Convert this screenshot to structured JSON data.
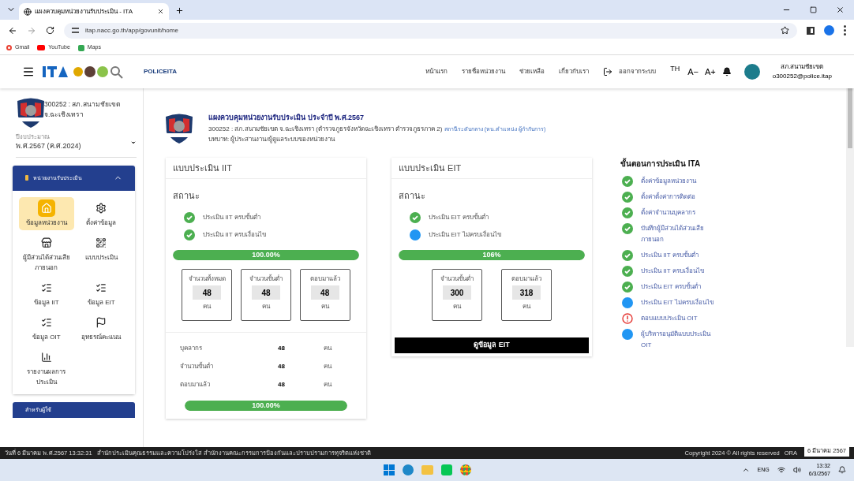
{
  "browser": {
    "tab_title": "แผงควบคุมหน่วยงานรับประเมิน - ITA",
    "url": "itap.nacc.go.th/app/govunit/home",
    "bookmarks": [
      {
        "label": "Gmail",
        "kind": "g"
      },
      {
        "label": "YouTube",
        "kind": "yt"
      },
      {
        "label": "Maps",
        "kind": "maps"
      }
    ]
  },
  "header": {
    "brand": "POLICEITA",
    "nav": [
      "หน้าแรก",
      "รายชื่อหน่วยงาน",
      "ช่วยเหลือ",
      "เกี่ยวกับเรา"
    ],
    "logout": "ออกจากระบบ",
    "lang": "TH",
    "font_down": "A−",
    "font_up": "A+",
    "user_name": "สภ.สนามชัยเขต",
    "user_email": "o300252@police.itap"
  },
  "sidebar": {
    "unit": "300252 : สภ.สนามชัยเขต จ.ฉะเชิงเทรา",
    "year_label": "ปีงบประมาณ",
    "year_value": "พ.ศ.2567 (ค.ศ.2024)",
    "section_title": "หน่วยงานรับประเมิน",
    "expanded": true,
    "items": [
      {
        "label": "ข้อมูลหน่วยงาน",
        "selected": true
      },
      {
        "label": "ตั้งค่าข้อมูล",
        "selected": false
      },
      {
        "label": "ผู้มีส่วนได้ส่วนเสียภายนอก",
        "selected": false
      },
      {
        "label": "แบบประเมิน",
        "selected": false
      },
      {
        "label": "ข้อมูล IIT",
        "selected": false
      },
      {
        "label": "ข้อมูล EIT",
        "selected": false
      },
      {
        "label": "ข้อมูล OIT",
        "selected": false
      },
      {
        "label": "อุทธรณ์คะแนน",
        "selected": false
      },
      {
        "label": "รายงานผลการประเมิน",
        "selected": false
      }
    ],
    "next_section": "สำหรับผู้ใช้"
  },
  "main": {
    "title": "แผงควบคุมหน่วยงานรับประเมิน ประจำปี พ.ศ.2567",
    "unit_line": "300252 : สภ.สนามชัยเขต จ.ฉะเชิงเทรา (ตำรวจภูธรจังหวัดฉะเชิงเทรา ตำรวจภูธรภาค 2)",
    "unit_link": "สถานีระดับกลาง (หน.ตำแหน่ง ผู้กำกับการ)",
    "role": "บทบาท: ผู้ประสานงาน/ผู้ดูแลระบบของหน่วยงาน"
  },
  "iit": {
    "title": "แบบประเมิน IIT",
    "status_label": "สถานะ",
    "statuses": [
      {
        "text": "ประเมิน IIT ครบขั้นต่ำ",
        "kind": "done"
      },
      {
        "text": "ประเมิน IIT ครบเงื่อนไข",
        "kind": "done"
      }
    ],
    "progress": {
      "level": 1,
      "label": "100.00%"
    },
    "stats": [
      {
        "label": "จำนวนทั้งหมด",
        "value": "48",
        "unit": "คน"
      },
      {
        "label": "จำนวนขั้นต่ำ",
        "value": "48",
        "unit": "คน"
      },
      {
        "label": "ตอบมาแล้ว",
        "value": "48",
        "unit": "คน"
      }
    ],
    "details": [
      {
        "label": "บุคลากร",
        "value": "48",
        "unit": "คน"
      },
      {
        "label": "จำนวนขั้นต่ำ",
        "value": "48",
        "unit": "คน"
      },
      {
        "label": "ตอบมาแล้ว",
        "value": "48",
        "unit": "คน"
      }
    ],
    "progress2": {
      "level": 1,
      "label": "100.00%"
    }
  },
  "eit": {
    "title": "แบบประเมิน EIT",
    "status_label": "สถานะ",
    "statuses": [
      {
        "text": "ประเมิน EIT ครบขั้นต่ำ",
        "kind": "done"
      },
      {
        "text": "ประเมิน EIT ไม่ครบเงื่อนไข",
        "kind": "pending"
      }
    ],
    "progress": {
      "level": 1,
      "label": "106%"
    },
    "stats": [
      {
        "label": "จำนวนขั้นต่ำ",
        "value": "300",
        "unit": "คน"
      },
      {
        "label": "ตอบมาแล้ว",
        "value": "318",
        "unit": "คน"
      }
    ],
    "button": "ดูข้อมูล EIT"
  },
  "steps": {
    "title": "ขั้นตอนการประเมิน ITA",
    "items": [
      {
        "text": "ตั้งค่าข้อมูลหน่วยงาน",
        "kind": "done"
      },
      {
        "text": "ตั้งค่าตั้งค่าการติดต่อ",
        "kind": "done"
      },
      {
        "text": "ตั้งค่าจำนวนบุคลากร",
        "kind": "done"
      },
      {
        "text": "บันทึกผู้มีส่วนได้ส่วนเสียภายนอก",
        "kind": "done"
      },
      {
        "text": "ประเมิน IIT ครบขั้นต่ำ",
        "kind": "done"
      },
      {
        "text": "ประเมิน IIT ครบเงื่อนไข",
        "kind": "done"
      },
      {
        "text": "ประเมิน EIT ครบขั้นต่ำ",
        "kind": "done"
      },
      {
        "text": "ประเมิน EIT ไม่ครบเงื่อนไข",
        "kind": "pending"
      },
      {
        "text": "ตอบแบบประเมิน OIT",
        "kind": "warning"
      },
      {
        "text": "ผู้บริหารอนุมัติแบบประเมิน OIT",
        "kind": "pending"
      }
    ]
  },
  "footer": {
    "datetime": "วันที่ 6 มีนาคม พ.ศ.2567 13:32:31",
    "org": "สำนักประเมินคุณธรรมและความโปร่งใส สำนักงานคณะกรรมการป้องกันและปราบปรามการทุจริตแห่งชาติ",
    "copyright": "Copyright 2024 © All rights reserved",
    "cut": "ORA",
    "tooltip": "6 มีนาคม 2567"
  },
  "taskbar": {
    "lang": "ENG",
    "time": "13:32",
    "date": "6/3/2567"
  }
}
